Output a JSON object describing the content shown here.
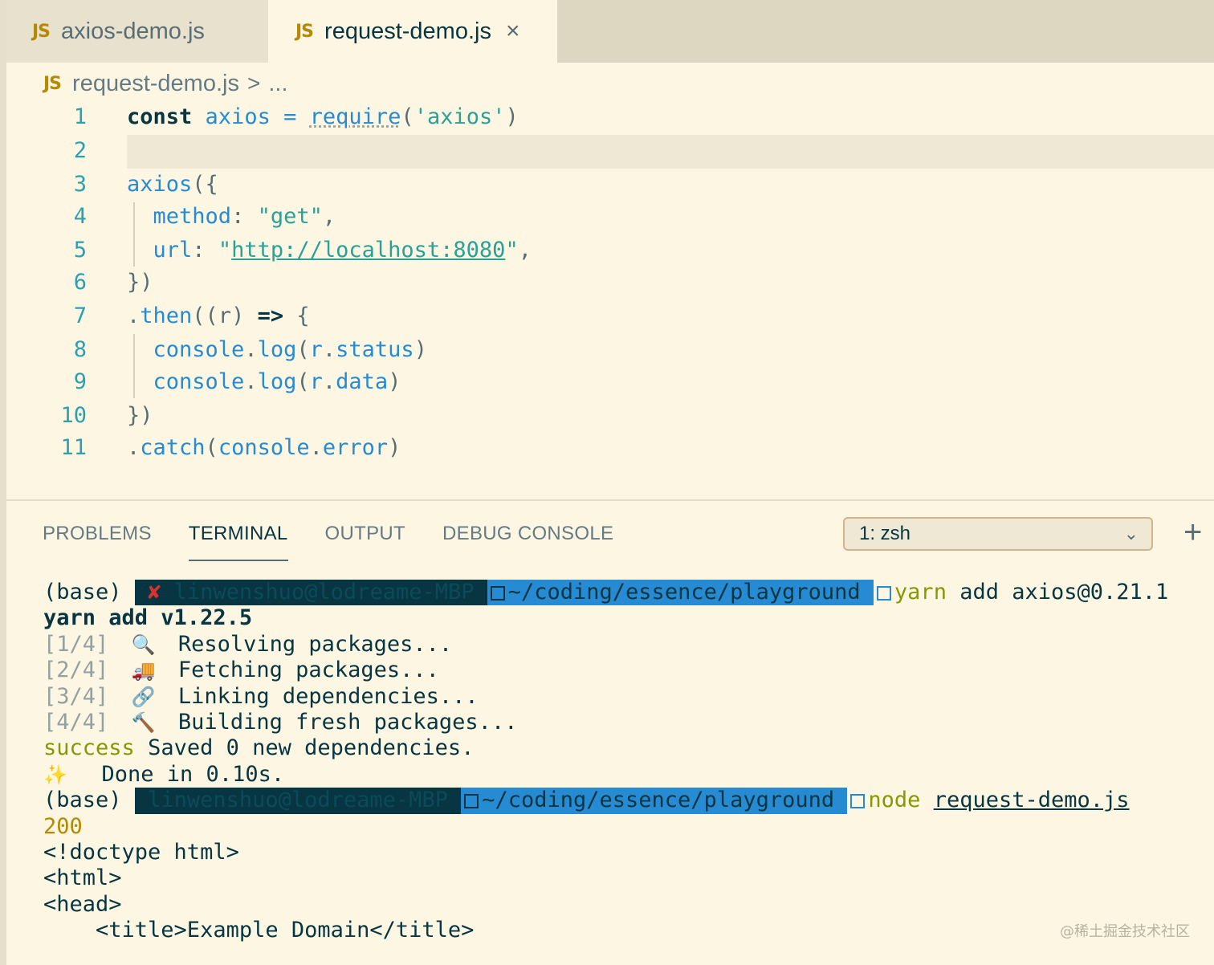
{
  "tabs": [
    {
      "icon": "JS",
      "label": "axios-demo.js",
      "active": false
    },
    {
      "icon": "JS",
      "label": "request-demo.js",
      "active": true,
      "close": "×"
    }
  ],
  "breadcrumb": {
    "icon": "JS",
    "file": "request-demo.js",
    "sep": ">",
    "more": "..."
  },
  "editor": {
    "line_numbers": [
      "1",
      "2",
      "3",
      "4",
      "5",
      "6",
      "7",
      "8",
      "9",
      "10",
      "11"
    ],
    "current_line": 2
  },
  "panel": {
    "tabs": [
      "PROBLEMS",
      "TERMINAL",
      "OUTPUT",
      "DEBUG CONSOLE"
    ],
    "active_tab": "TERMINAL",
    "terminal_select": "1: zsh",
    "add_label": "+"
  },
  "terminal": {
    "prompt_base": "(base)",
    "prompt_user": "linwenshuo@lodreame-MBP",
    "prompt_path": "~/coding/essence/playground",
    "cmd1_name": "yarn",
    "cmd1_args": "add axios@0.21.1",
    "yarn_version": "yarn add v1.22.5",
    "steps": [
      {
        "num": "[1/4]",
        "icon": "🔍",
        "text": "Resolving packages..."
      },
      {
        "num": "[2/4]",
        "icon": "🚚",
        "text": "Fetching packages..."
      },
      {
        "num": "[3/4]",
        "icon": "🔗",
        "text": "Linking dependencies..."
      },
      {
        "num": "[4/4]",
        "icon": "🔨",
        "text": "Building fresh packages..."
      }
    ],
    "success_word": "success",
    "success_text": "Saved 0 new dependencies.",
    "done_icon": "✨",
    "done_text": "Done in 0.10s.",
    "cmd2_name": "node",
    "cmd2_args": "request-demo.js",
    "output": [
      "200",
      "<!doctype html>",
      "<html>",
      "<head>",
      "    <title>Example Domain</title>"
    ]
  },
  "watermark": "@稀土掘金技术社区",
  "colors": {
    "background": "#fdf6e3",
    "accent": "#268bd2",
    "string": "#2aa198",
    "error": "#dc322f"
  }
}
